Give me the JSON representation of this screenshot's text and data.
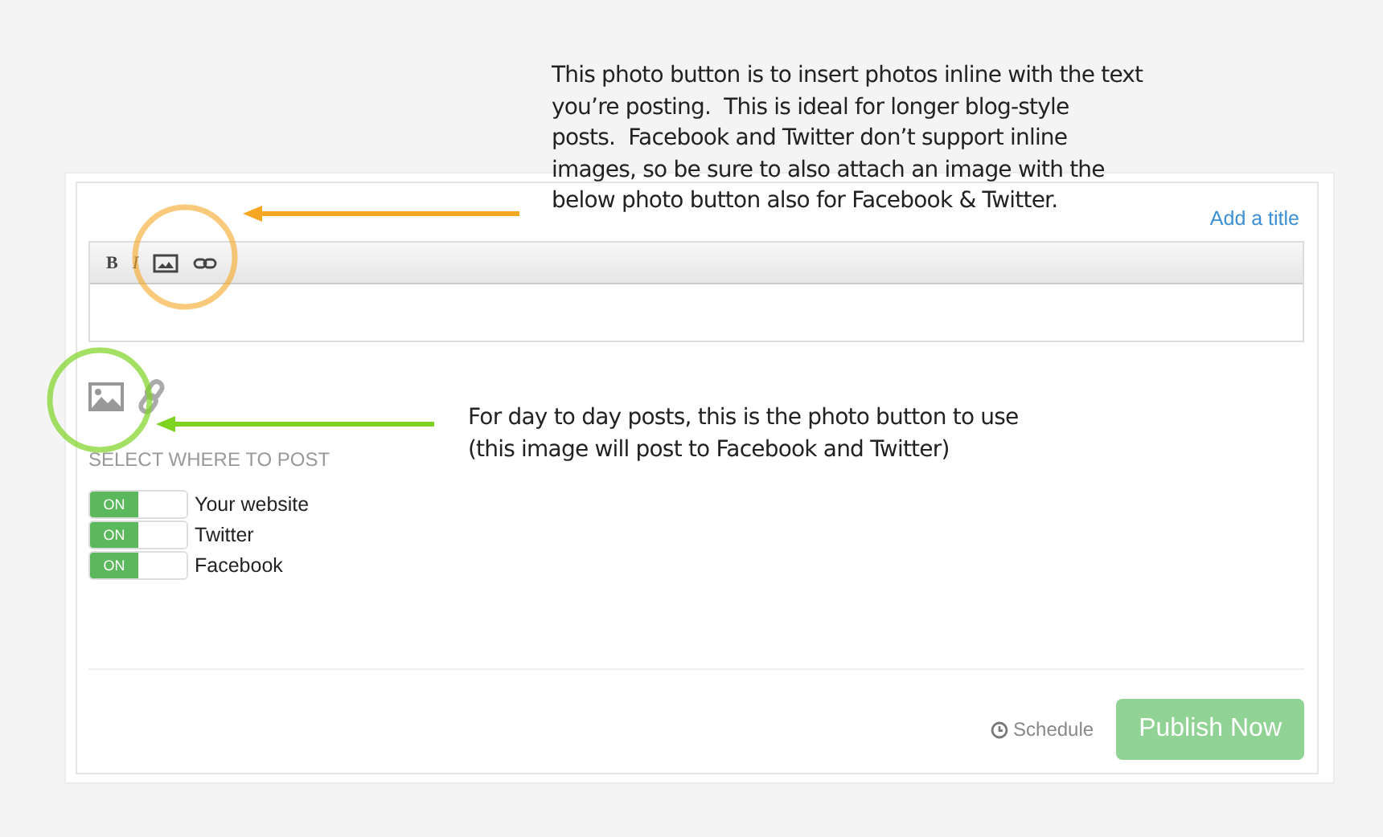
{
  "annotations": [
    {
      "text": "This photo button is to insert photos inline with the text\nyou’re posting.  This is ideal for longer blog-style\nposts.  Facebook and Twitter don’t support inline\nimages, so be sure to also attach an image with the\nbelow photo button also for Facebook & Twitter.",
      "color": "#f5a623"
    },
    {
      "text": "For day to day posts, this is the photo button to use\n(this image will post to Facebook and Twitter)",
      "color": "#7ed321"
    }
  ],
  "composer": {
    "add_title": "Add a title",
    "toolbar": [
      "B",
      "I"
    ],
    "section_label": "SELECT WHERE TO POST",
    "destinations": [
      {
        "label": "Your website",
        "on": true,
        "state_text": "ON"
      },
      {
        "label": "Twitter",
        "on": true,
        "state_text": "ON"
      },
      {
        "label": "Facebook",
        "on": true,
        "state_text": "ON"
      }
    ],
    "schedule": "Schedule",
    "publish": "Publish Now"
  }
}
